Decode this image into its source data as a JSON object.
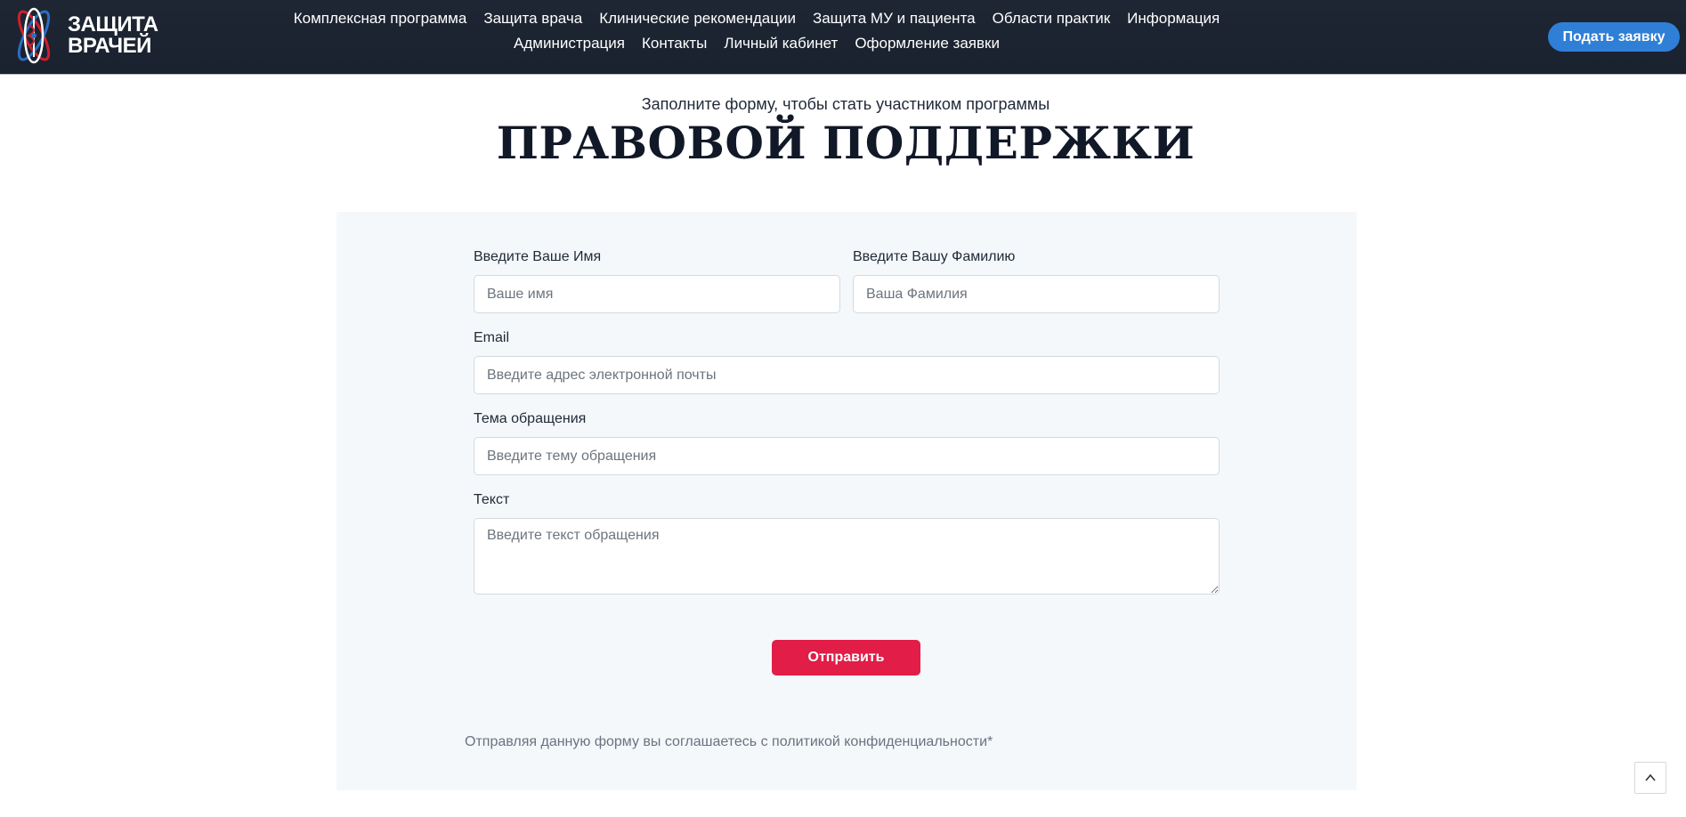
{
  "header": {
    "logo": {
      "line1": "ЗАЩИТА",
      "line2": "ВРАЧЕЙ"
    },
    "nav": [
      {
        "label": "Комплексная программа"
      },
      {
        "label": "Защита врача"
      },
      {
        "label": "Клинические рекомендации"
      },
      {
        "label": "Защита МУ и пациента"
      },
      {
        "label": "Области практик"
      },
      {
        "label": "Информация"
      },
      {
        "label": "Администрация"
      },
      {
        "label": "Контакты"
      },
      {
        "label": "Личный кабинет"
      },
      {
        "label": "Оформление заявки"
      }
    ],
    "cta_label": "Подать заявку"
  },
  "hero": {
    "subtitle": "Заполните форму, чтобы стать участником программы",
    "title": "ПРАВОВОЙ ПОДДЕРЖКИ"
  },
  "form": {
    "first_name": {
      "label": "Введите Ваше Имя",
      "placeholder": "Ваше имя",
      "value": ""
    },
    "last_name": {
      "label": "Введите Вашу Фамилию",
      "placeholder": "Ваша Фамилия",
      "value": ""
    },
    "email": {
      "label": "Email",
      "placeholder": "Введите адрес электронной почты",
      "value": ""
    },
    "subject": {
      "label": "Тема обращения",
      "placeholder": "Введите тему обращения",
      "value": ""
    },
    "message": {
      "label": "Текст",
      "placeholder": "Введите текст обращения",
      "value": ""
    },
    "submit_label": "Отправить",
    "policy_text": "Отправляя данную форму вы соглашаетесь с политикой конфиденциальности*"
  },
  "colors": {
    "header_bg": "#1e2633",
    "cta": "#2f7fd6",
    "submit": "#e11d48",
    "card_bg": "#f5f8fb"
  },
  "icons": {
    "logo": "atom-caduceus-logo-icon",
    "scroll_top": "chevron-up-icon"
  }
}
